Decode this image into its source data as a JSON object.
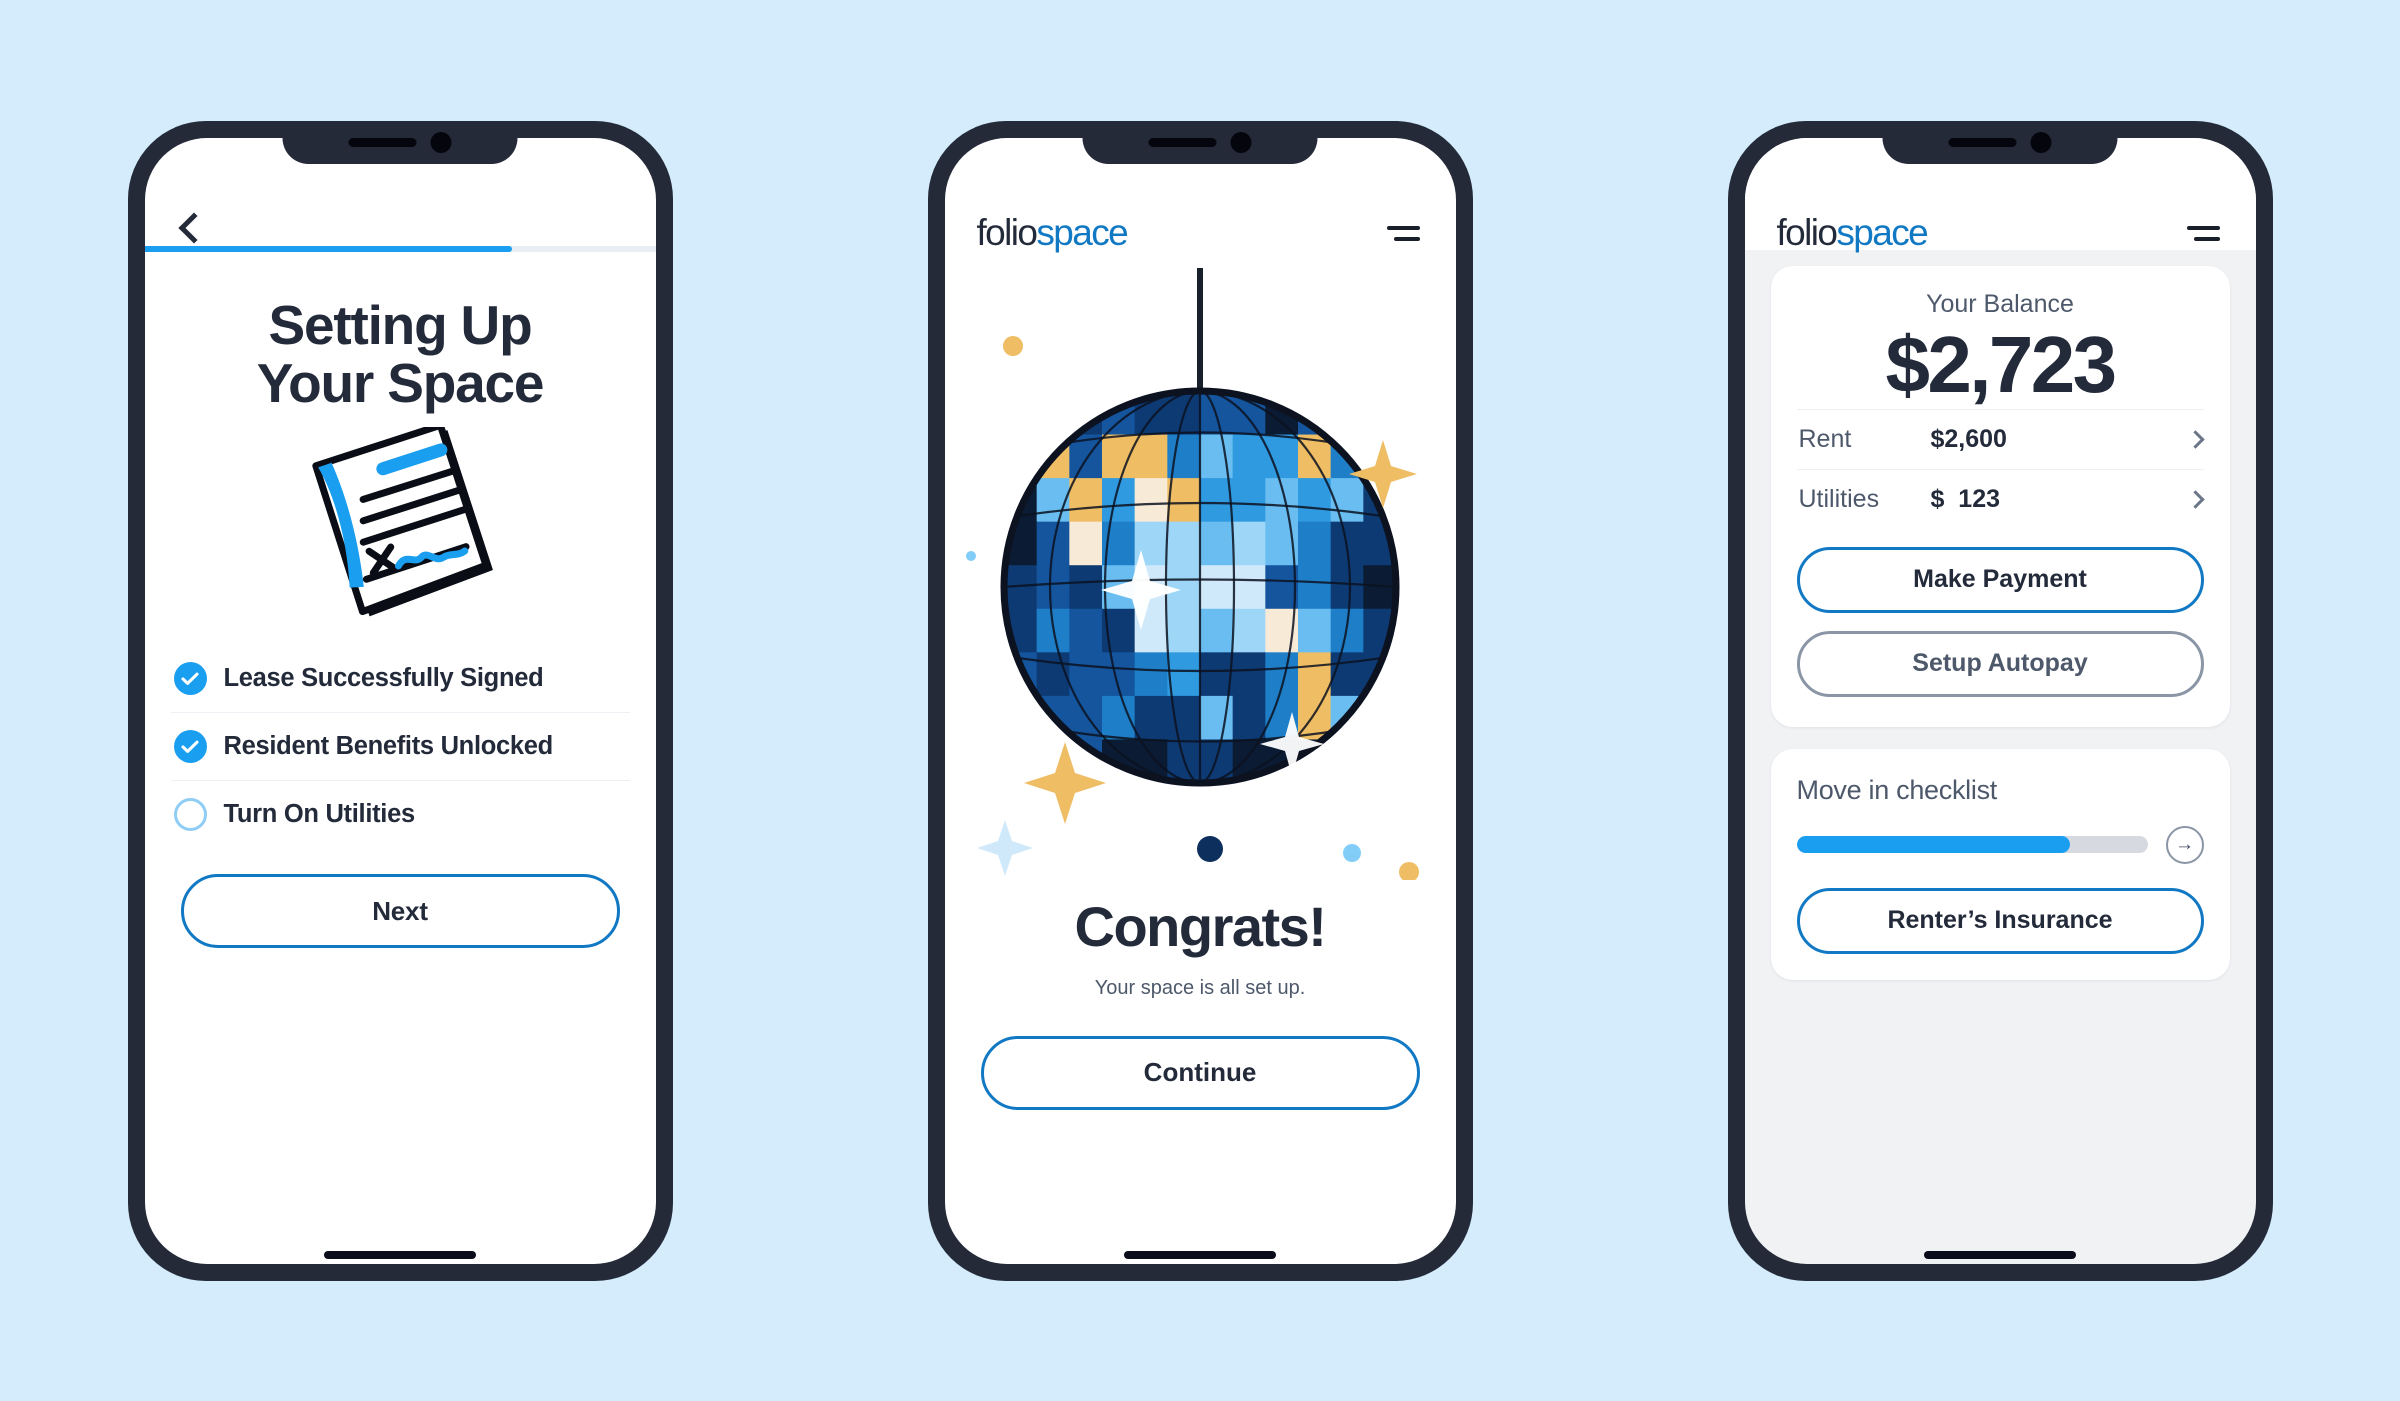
{
  "theme": {
    "page_background": "#d4ecfb",
    "accent_blue": "#1a9ef0",
    "link_blue": "#1179c4",
    "navy": "#232a3a",
    "gray_text": "#4d596b",
    "gold": "#efbd63",
    "card_bg": "#ffffff",
    "screen3_bg": "#f1f2f4"
  },
  "brand": {
    "name_part1": "folio",
    "name_part2": "space",
    "menu_icon": "hamburger-menu-icon"
  },
  "screen1": {
    "back_icon": "chevron-left-icon",
    "progress_percent": 72,
    "title_line1": "Setting Up",
    "title_line2": "Your Space",
    "illustration": "signed-lease-document-icon",
    "checklist": [
      {
        "label": "Lease Successfully Signed",
        "state": "done",
        "icon": "check-circle-icon"
      },
      {
        "label": "Resident Benefits Unlocked",
        "state": "done",
        "icon": "check-circle-icon"
      },
      {
        "label": "Turn On Utilities",
        "state": "todo",
        "icon": "empty-circle-icon"
      }
    ],
    "next_label": "Next"
  },
  "screen2": {
    "illustration": "disco-ball-icon",
    "heading": "Congrats!",
    "subtitle": "Your space is all set up.",
    "continue_label": "Continue"
  },
  "screen3": {
    "balance_label": "Your Balance",
    "balance_amount": "$2,723",
    "lines": [
      {
        "label": "Rent",
        "value": "$2,600",
        "icon": "chevron-right-icon"
      },
      {
        "label": "Utilities",
        "value": "$  123",
        "icon": "chevron-right-icon"
      }
    ],
    "primary_button": "Make Payment",
    "secondary_button": "Setup Autopay",
    "checklist_title": "Move in checklist",
    "checklist_progress_percent": 78,
    "checklist_arrow_icon": "arrow-right-circle-icon",
    "insurance_button": "Renter’s Insurance"
  }
}
